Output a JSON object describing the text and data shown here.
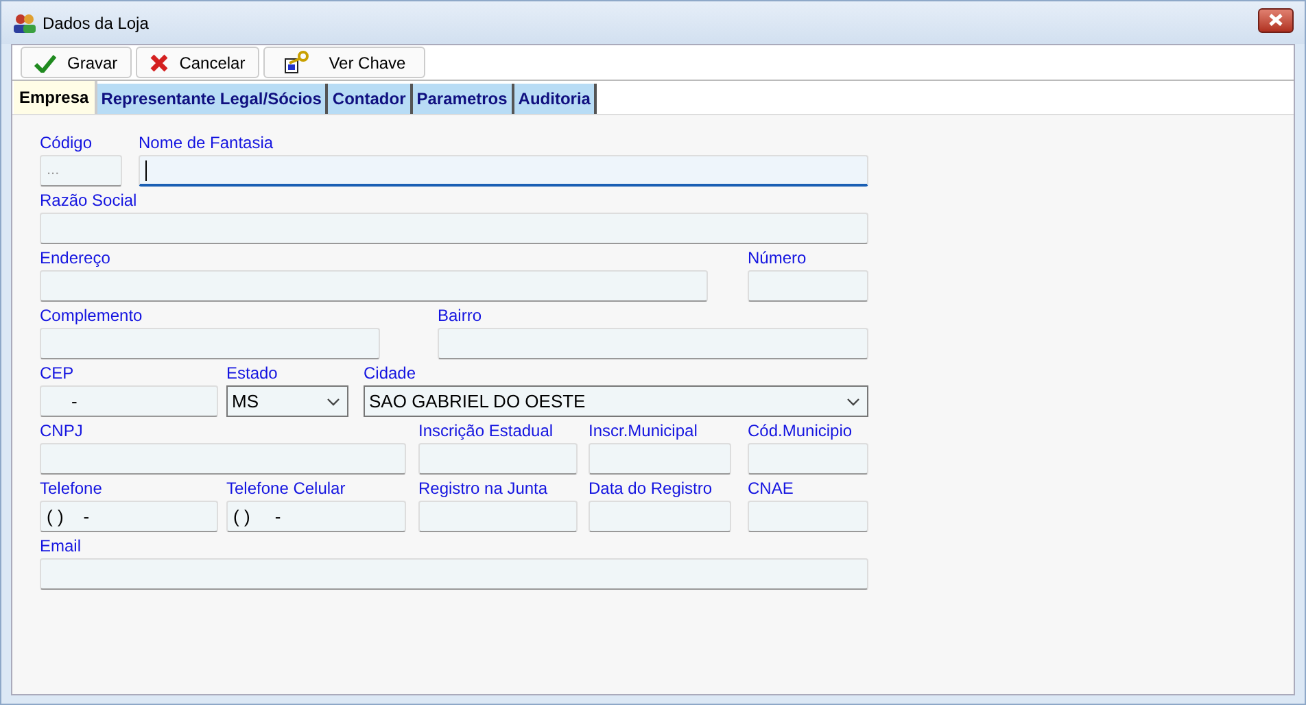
{
  "window": {
    "title": "Dados da Loja"
  },
  "toolbar": [
    {
      "label": "Gravar",
      "kind": "save"
    },
    {
      "label": "Cancelar",
      "kind": "cancel"
    },
    {
      "label": "Ver Chave",
      "kind": "key"
    }
  ],
  "tabs": [
    {
      "label": "Empresa",
      "selected": true
    },
    {
      "label": "Representante Legal/Sócios",
      "selected": false
    },
    {
      "label": "Contador",
      "selected": false
    },
    {
      "label": "Parametros",
      "selected": false
    },
    {
      "label": "Auditoria",
      "selected": false
    }
  ],
  "form_rows": [
    [
      {
        "label": "Código",
        "kind": "text",
        "placeholder": "...",
        "focused": false
      },
      {
        "label": "Nome de Fantasia",
        "kind": "text",
        "focused": true
      }
    ],
    [
      {
        "label": "Razão Social",
        "kind": "text",
        "focused": false
      }
    ],
    [
      {
        "label": "Endereço",
        "kind": "text",
        "focused": false
      },
      {
        "label": "Número",
        "kind": "text",
        "focused": false
      }
    ],
    [
      {
        "label": "Complemento",
        "kind": "text",
        "focused": false
      },
      {
        "label": "Bairro",
        "kind": "text",
        "focused": false
      }
    ],
    [
      {
        "label": "CEP",
        "kind": "text",
        "value": "     -",
        "focused": false
      },
      {
        "label": "Estado",
        "kind": "select",
        "value": "MS",
        "focused": false
      },
      {
        "label": "Cidade",
        "kind": "select",
        "value": "SAO GABRIEL DO OESTE",
        "focused": false
      }
    ],
    [
      {
        "label": "CNPJ",
        "kind": "text",
        "focused": false
      },
      {
        "label": "Inscrição Estadual",
        "kind": "text",
        "focused": false
      },
      {
        "label": "Inscr.Municipal",
        "kind": "text",
        "focused": false
      },
      {
        "label": "Cód.Municipio",
        "kind": "text",
        "focused": false
      }
    ],
    [
      {
        "label": "Telefone",
        "kind": "text",
        "value": "( )    -",
        "focused": false
      },
      {
        "label": "Telefone Celular",
        "kind": "text",
        "value": "( )     -",
        "focused": false
      },
      {
        "label": "Registro na Junta",
        "kind": "text",
        "focused": false
      },
      {
        "label": "Data do Registro",
        "kind": "text",
        "focused": false
      },
      {
        "label": "CNAE",
        "kind": "text",
        "focused": false
      }
    ],
    [
      {
        "label": "Email",
        "kind": "text",
        "focused": false
      }
    ]
  ]
}
